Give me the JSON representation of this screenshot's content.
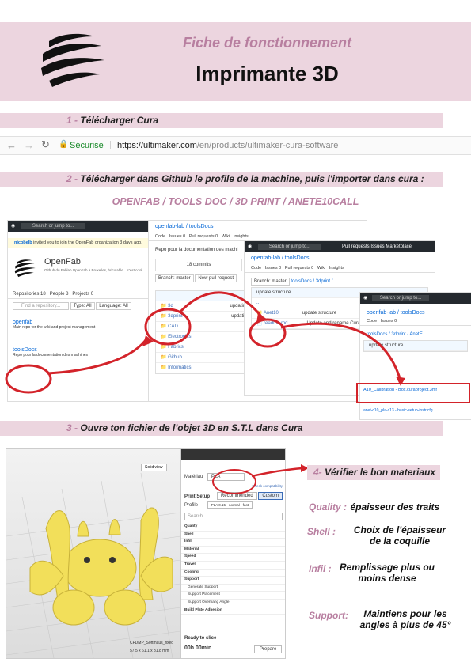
{
  "header": {
    "subtitle": "Fiche de fonctionnement",
    "title": "Imprimante 3D"
  },
  "steps": [
    {
      "num": "1 -",
      "text": "Télécharger Cura"
    },
    {
      "num": "2 -",
      "text": "Télécharger dans Github le profile de la machine, puis l'importer dans cura :"
    },
    {
      "num": "3 -",
      "text": "Ouvre ton fichier de l'objet 3D en S.T.L dans Cura"
    },
    {
      "num": "4-",
      "text": "Vérifier le bon materiaux"
    }
  ],
  "browser": {
    "secure": "Sécurisé",
    "url_host": "https://ultimaker.com",
    "url_path": "/en/products/ultimaker-cura-software"
  },
  "path_heading": "OPENFAB / TOOLS DOC / 3D PRINT / ANETE10CALL",
  "github": {
    "nav_search": "Search or jump to...",
    "pull_requests": "Pull requests",
    "issues": "Issues",
    "marketplace": "Marketplace",
    "invite": "invited you to join the OpenFab organization 3 days ago.",
    "inviter": "nicobelb",
    "org_name": "OpenFab",
    "org_desc": "Github du Fablab OpenFab à Bruxelles, bricolable... c'est cool.",
    "tabs": [
      "Repositories 18",
      "People 8",
      "Projects 0"
    ],
    "find_repo": "Find a repository...",
    "type_btn": "Type: All",
    "lang_btn": "Language: All",
    "repo1_name": "openfab",
    "repo1_desc": "Main repo for the wiki and project management",
    "repo2_name": "toolsDocs",
    "repo2_desc": "Repo pour la documentation des machines",
    "repo_path": "openfab-lab / toolsDocs",
    "code_tab": "Code",
    "issues_tab": "Issues 0",
    "pr_tab": "Pull requests 0",
    "wiki_tab": "Wiki",
    "insights_tab": "Insights",
    "repo_desc": "Repo pour la documentation des machi",
    "commits": "18 commits",
    "branch": "Branch: master",
    "new_pr": "New pull request",
    "folders": [
      "3d",
      "3dprint",
      "CAD",
      "Electronics",
      "Fabrics",
      "Github",
      "Informatics"
    ],
    "updating": "updating",
    "sub_path": "toolsDocs / 3dprint /",
    "sub_folders": [
      "..",
      "Anet10",
      "readme.md"
    ],
    "update_structure": "update structure",
    "update_readme": "Update and rename Cura-1",
    "file_path": "toolsDocs / 3dprint / AnetE",
    "files": [
      "A10_Calibration - Box.curaproject.3mf",
      "anet-c10_pla-c13 - basic-setup-instr.cfg"
    ]
  },
  "cura": {
    "material_label": "Matériau",
    "material_value": "PLA",
    "check": "Check compatibility",
    "print_setup": "Print Setup",
    "recommended": "Recommended",
    "custom": "Custom",
    "profile": "Profile",
    "profile_value": "PLA 0.15 - normal - fast",
    "search": "Search...",
    "settings": [
      "Quality",
      "Shell",
      "Infill",
      "Material",
      "Speed",
      "Travel",
      "Cooling",
      "Support",
      "Generate Support",
      "Support Placement",
      "Support Overhang Angle",
      "Build Plate Adhesion"
    ],
    "ready": "Ready to slice",
    "time": "00h 00min",
    "prepare": "Prepare",
    "model_name": "CFDMP_Softmaus_fixed",
    "dims": "57.5 x 61.1 x 31.8 mm",
    "view": "Solid view"
  },
  "checks": [
    {
      "label": "Quality :",
      "desc": "épaisseur des traits"
    },
    {
      "label": "Shell :",
      "desc": "Choix de l'épaisseur de la coquille"
    },
    {
      "label": "Infil :",
      "desc": "Remplissage plus ou moins dense"
    },
    {
      "label": "Support:",
      "desc": "Maintiens pour les angles à plus de 45°"
    }
  ],
  "colors": {
    "accent": "#b87fa0",
    "band": "#ecd5df",
    "red": "#d3232a"
  }
}
